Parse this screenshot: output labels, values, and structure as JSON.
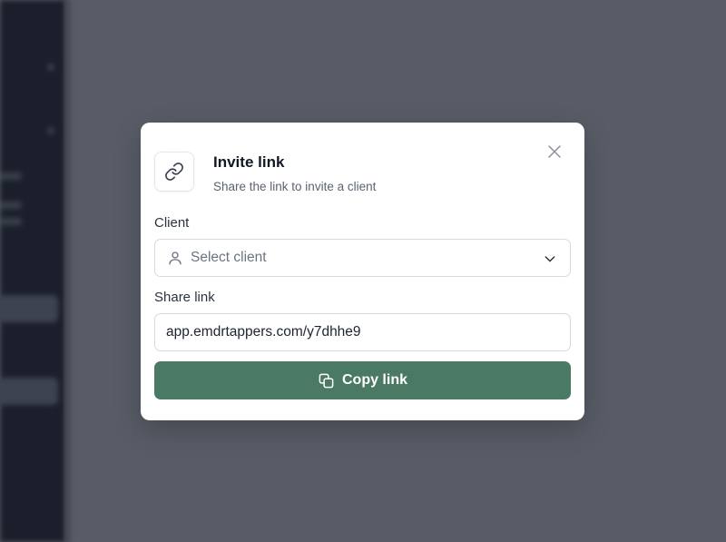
{
  "modal": {
    "title": "Invite link",
    "subtitle": "Share the link to invite a client",
    "header_icon": "link-icon",
    "close_icon": "close-icon"
  },
  "client_field": {
    "label": "Client",
    "placeholder": "Select client",
    "icon": "user-icon",
    "dropdown_icon": "chevron-down-icon"
  },
  "share_field": {
    "label": "Share link",
    "value": "app.emdrtappers.com/y7dhhe9"
  },
  "copy_button": {
    "label": "Copy link",
    "icon": "copy-icon"
  },
  "colors": {
    "primary": "#4a7a64",
    "overlay": "#585c66",
    "sidebar": "#1b1f2b"
  }
}
